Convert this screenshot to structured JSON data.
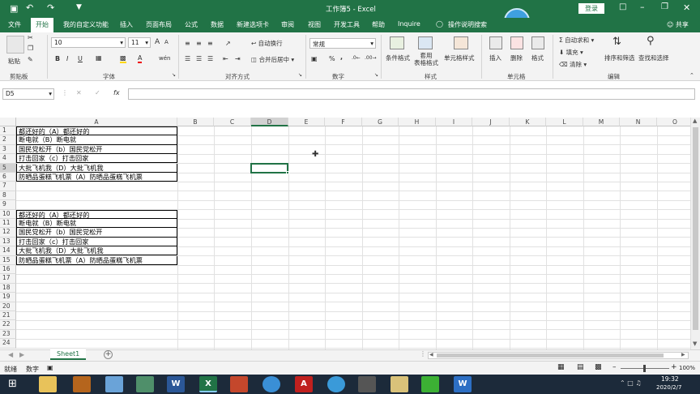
{
  "titlebar": {
    "title": "工作簿5 - Excel",
    "login_label": "登录"
  },
  "tabs": [
    "文件",
    "开始",
    "我的自定义功能",
    "插入",
    "页面布局",
    "公式",
    "数据",
    "新建选项卡",
    "审阅",
    "视图",
    "开发工具",
    "帮助",
    "Inquire",
    "操作说明搜索"
  ],
  "share_label": "共享",
  "ribbon": {
    "clipboard": {
      "paste": "粘贴",
      "group": "剪贴板"
    },
    "font": {
      "name": "等线",
      "size": "11",
      "size2": "10",
      "group": "字体",
      "bold": "B",
      "italic": "I",
      "underline": "U",
      "grow": "A",
      "shrink": "A",
      "phonetic": "wén"
    },
    "alignment": {
      "wrap": "自动换行",
      "merge": "合并后居中",
      "group": "对齐方式"
    },
    "number": {
      "format": "常规",
      "group": "数字",
      "percent": "%",
      "comma": ","
    },
    "styles": {
      "conditional": "条件格式",
      "table": "套用\n表格格式",
      "cell": "单元格样式",
      "group": "样式"
    },
    "cells": {
      "insert": "插入",
      "delete": "删除",
      "format": "格式",
      "group": "单元格"
    },
    "editing": {
      "autosum": "自动求和",
      "fill": "填充",
      "clear": "清除",
      "sort": "排序和筛选",
      "find": "查找和选择",
      "group": "编辑"
    }
  },
  "formula_bar": {
    "name_box": "D5",
    "fx": "fx",
    "value": ""
  },
  "columns": [
    "A",
    "B",
    "C",
    "D",
    "E",
    "F",
    "G",
    "H",
    "I",
    "J",
    "K",
    "L",
    "M",
    "N",
    "O"
  ],
  "rows": [
    "1",
    "2",
    "3",
    "4",
    "5",
    "6",
    "7",
    "8",
    "9",
    "10",
    "11",
    "12",
    "13",
    "14",
    "15",
    "16",
    "17",
    "18",
    "19",
    "20",
    "21",
    "22",
    "23",
    "24"
  ],
  "cells_block1": [
    "都还好的（A）都还好的",
    "断电就（B）断电就",
    "国民党松开（b）国民党松开",
    "打击回家（c）打击回家",
    "大批飞机我（D）大批飞机我",
    "防晒品蛋糕飞机票（A）防晒品蛋糕飞机票"
  ],
  "cells_block2": [
    "都还好的（A）都还好的",
    "断电就（B）断电就",
    "国民党松开（b）国民党松开",
    "打击回家（c）打击回家",
    "大批飞机我（D）大批飞机我",
    "防晒品蛋糕飞机票（A）防晒品蛋糕飞机票"
  ],
  "sheet": {
    "name": "Sheet1",
    "add": "+"
  },
  "status": {
    "ready": "就绪",
    "mode": "数字",
    "zoom": "100%"
  },
  "clock": {
    "time": "19:32",
    "date": "2020/2/7"
  }
}
